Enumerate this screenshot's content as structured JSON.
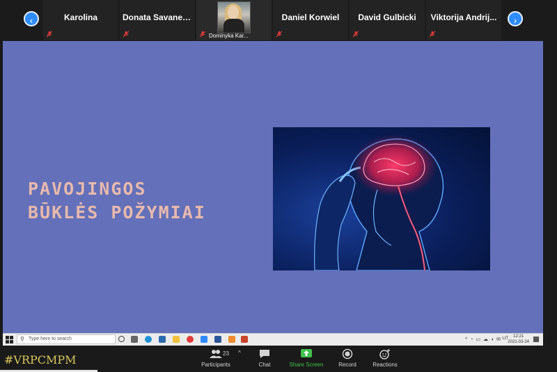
{
  "participants": {
    "tiles": [
      {
        "name": "Karolina"
      },
      {
        "name": "Donata  Savanev..."
      },
      {
        "name": "Dominyka Kar...",
        "has_video": true
      },
      {
        "name": "Daniel Korwiel"
      },
      {
        "name": "David Gulbicki"
      },
      {
        "name": "Viktorija  Andrij..."
      }
    ],
    "prev_icon": "‹",
    "next_icon": "›"
  },
  "slide": {
    "title_line1": "PAVOJINGOS",
    "title_line2": "BŪKLĖS  POŽYMIAI",
    "bg_color": "#6470b9",
    "title_color": "#e8b9ad"
  },
  "taskbar": {
    "search_placeholder": "Type here to search",
    "lang": "LIT",
    "time": "12:21",
    "date": "2021-03-24"
  },
  "zoom_toolbar": {
    "participants_count": "23",
    "participants_label": "Participants",
    "chat_label": "Chat",
    "share_label": "Share Screen",
    "record_label": "Record",
    "reactions_label": "Reactions",
    "share_color": "#41c14b"
  },
  "overlay": {
    "hashtag": "#VRPCMPM"
  }
}
